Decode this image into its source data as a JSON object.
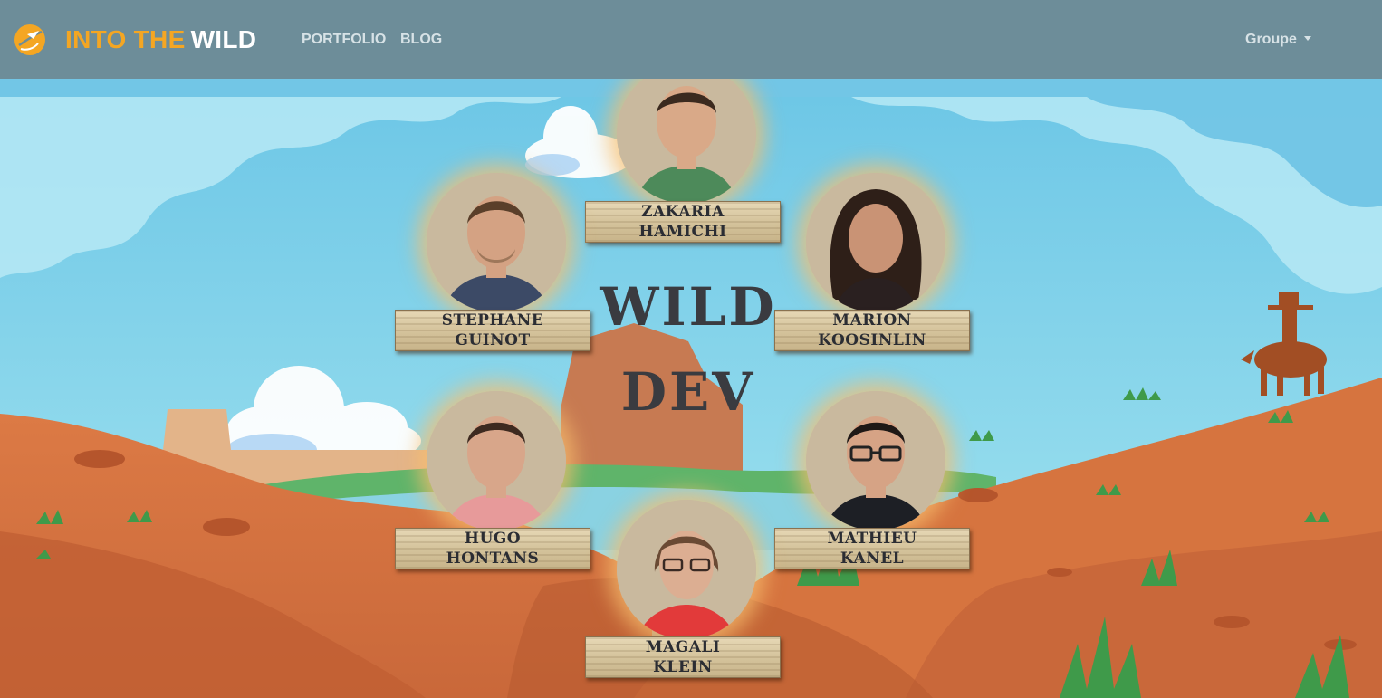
{
  "navbar": {
    "brand_part1": "INTO THE",
    "brand_part2": "WILD",
    "logo_icon": "orange-globe-plane-icon",
    "links": [
      {
        "label": "PORTFOLIO"
      },
      {
        "label": "BLOG"
      }
    ],
    "dropdown_label": "Groupe"
  },
  "hero": {
    "title_line1": "WILD",
    "title_line2": "DEV"
  },
  "members": [
    {
      "first": "ZAKARIA",
      "last": "HAMICHI"
    },
    {
      "first": "STEPHANE",
      "last": "GUINOT"
    },
    {
      "first": "MARION",
      "last": "KOOSINLIN"
    },
    {
      "first": "HUGO",
      "last": "HONTANS"
    },
    {
      "first": "MATHIEU",
      "last": "KANEL"
    },
    {
      "first": "MAGALI",
      "last": "KLEIN"
    }
  ],
  "colors": {
    "navbar": "#6d8d99",
    "brand_accent": "#f4a623",
    "sky": "#7ed3e8",
    "desert": "#d2733f"
  }
}
